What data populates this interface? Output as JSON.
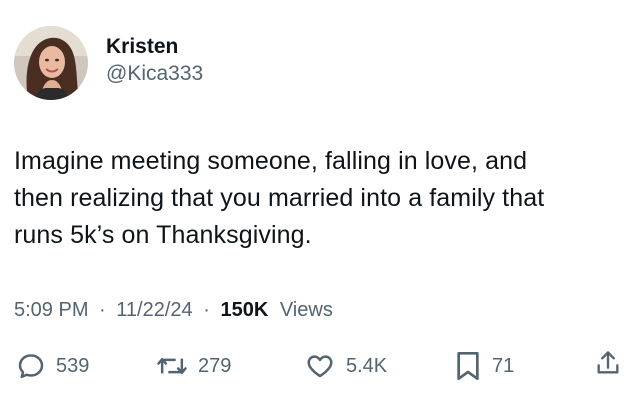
{
  "tweet": {
    "author": {
      "display_name": "Kristen",
      "handle": "@Kica333"
    },
    "text_lines": [
      "Imagine meeting someone, falling in love, and",
      "then realizing that you married into a family that",
      "runs 5k’s on Thanksgiving."
    ],
    "meta": {
      "time": "5:09 PM",
      "separator": "·",
      "date": "11/22/24",
      "views_count": "150K",
      "views_label": "Views"
    },
    "actions": {
      "replies": "539",
      "reposts": "279",
      "likes": "5.4K",
      "bookmarks": "71"
    },
    "icons": {
      "reply": "reply-icon",
      "repost": "repost-icon",
      "like": "heart-icon",
      "bookmark": "bookmark-icon",
      "share": "share-icon"
    },
    "colors": {
      "text_primary": "#0f1419",
      "text_secondary": "#536471",
      "background": "#ffffff"
    }
  }
}
